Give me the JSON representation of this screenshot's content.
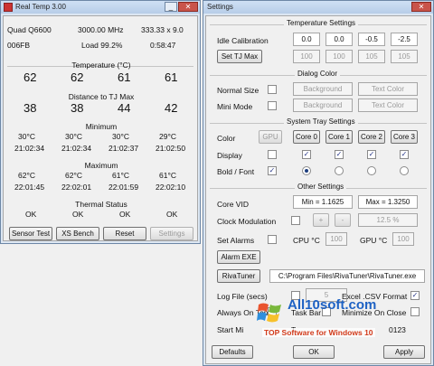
{
  "realtemp": {
    "title": "Real Temp 3.00",
    "cpu": "Quad Q6600",
    "freq": "3000.00 MHz",
    "mult": "333.33 x 9.0",
    "id": "006FB",
    "load": "Load  99.2%",
    "time": "0:58:47",
    "temp_label": "Temperature (°C)",
    "temps": [
      "62",
      "62",
      "61",
      "61"
    ],
    "dist_label": "Distance to TJ Max",
    "dists": [
      "38",
      "38",
      "44",
      "42"
    ],
    "min_label": "Minimum",
    "mins": [
      "30°C",
      "30°C",
      "30°C",
      "29°C"
    ],
    "min_times": [
      "21:02:34",
      "21:02:34",
      "21:02:37",
      "21:02:50"
    ],
    "max_label": "Maximum",
    "maxs": [
      "62°C",
      "62°C",
      "61°C",
      "61°C"
    ],
    "max_times": [
      "22:01:45",
      "22:02:01",
      "22:01:59",
      "22:02:10"
    ],
    "thermal_label": "Thermal Status",
    "status": [
      "OK",
      "OK",
      "OK",
      "OK"
    ],
    "buttons": [
      "Sensor Test",
      "XS Bench",
      "Reset",
      "Settings"
    ]
  },
  "settings": {
    "title": "Settings",
    "temp_settings": "Temperature Settings",
    "idle_label": "Idle Calibration",
    "idle_vals": [
      "0.0",
      "0.0",
      "-0.5",
      "-2.5"
    ],
    "set_tjmax": "Set TJ Max",
    "tjmax_vals": [
      "100",
      "100",
      "105",
      "105"
    ],
    "dialog_color": "Dialog Color",
    "normal_size": "Normal Size",
    "mini_mode": "Mini Mode",
    "background": "Background",
    "text_color": "Text Color",
    "tray_settings": "System Tray Settings",
    "color_label": "Color",
    "gpu": "GPU",
    "cores": [
      "Core 0",
      "Core 1",
      "Core 2",
      "Core 3"
    ],
    "display_label": "Display",
    "bold_label": "Bold / Font",
    "other_settings": "Other Settings",
    "core_vid": "Core VID",
    "min_vid": "Min = 1.1625",
    "max_vid": "Max = 1.3250",
    "clock_mod": "Clock Modulation",
    "plus": "+",
    "minus": "-",
    "clock_pct": "12.5 %",
    "set_alarms": "Set Alarms",
    "cpu_c": "CPU °C",
    "cpu_alarm": "100",
    "gpu_c": "GPU °C",
    "gpu_alarm": "100",
    "alarm_exe": "Alarm EXE",
    "rivatuner": "RivaTuner",
    "riva_path": "C:\\Program Files\\RivaTuner\\RivaTuner.exe",
    "log_file": "Log File (secs)",
    "log_secs": "5",
    "excel": "Excel .CSV Format",
    "always_top": "Always On Top",
    "task_bar": "Task Bar",
    "min_close": "Minimize On Close",
    "start_min": "Start Mi",
    "t_label": "T",
    "code": "0123",
    "defaults": "Defaults",
    "ok": "OK",
    "apply": "Apply"
  },
  "watermark": {
    "site": "All10soft.com",
    "tagline": "TOP Software for Windows 10"
  }
}
